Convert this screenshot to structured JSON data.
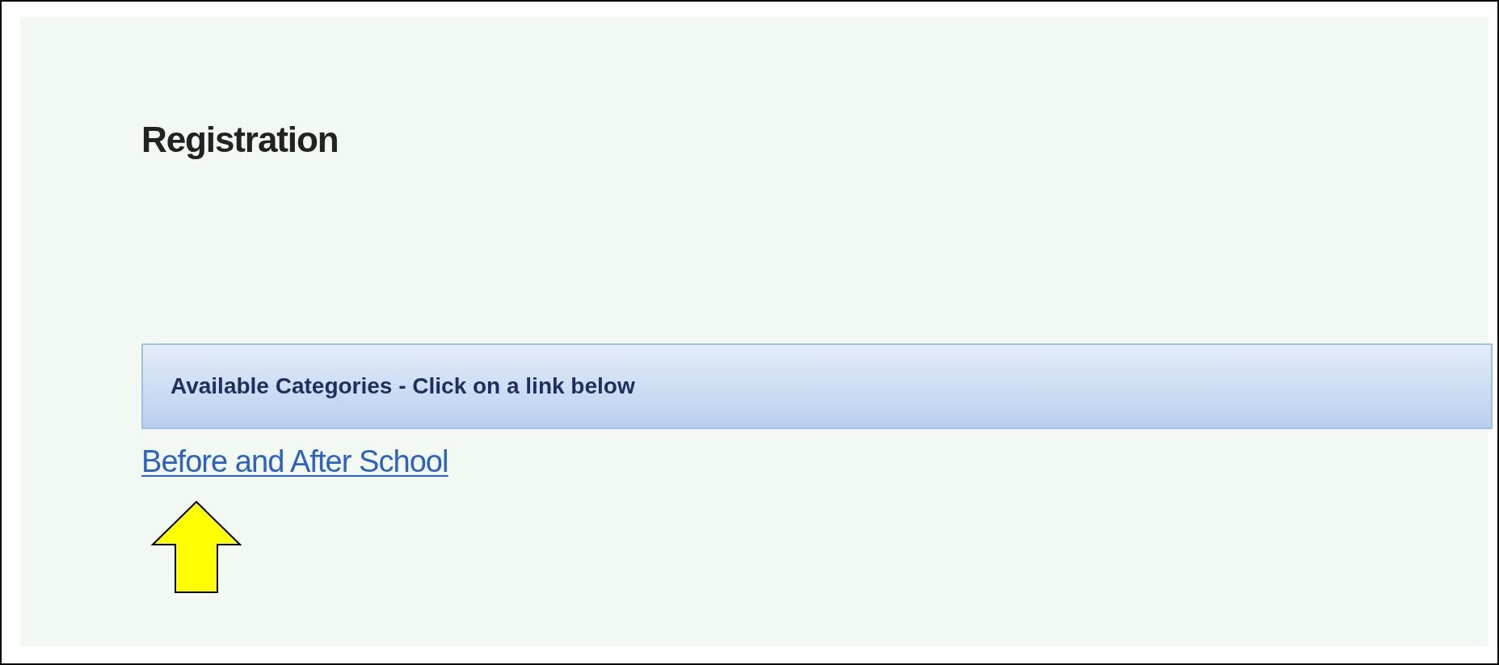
{
  "page": {
    "title": "Registration"
  },
  "categories_header": {
    "text": "Available Categories - Click on a link below"
  },
  "links": [
    {
      "label": "Before and After School"
    }
  ]
}
